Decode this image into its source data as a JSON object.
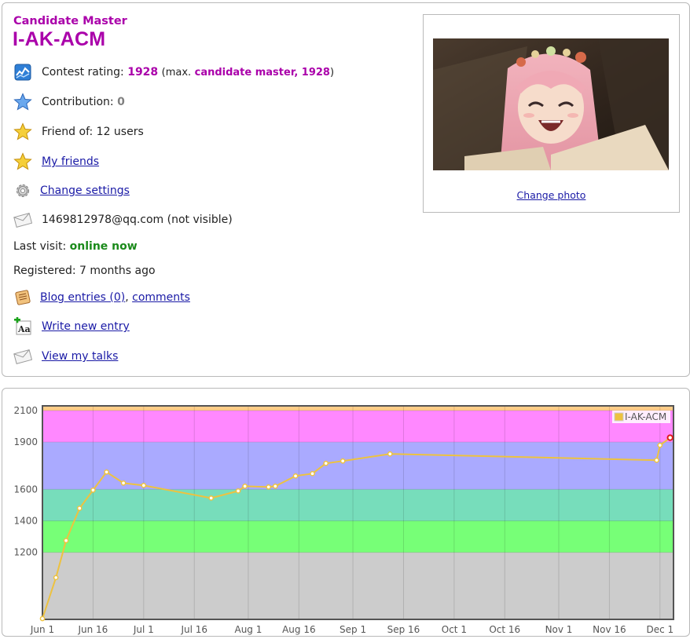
{
  "profile": {
    "rank": "Candidate Master",
    "handle": "I-AK-ACM",
    "contest_rating_label": "Contest rating:",
    "contest_rating_value": "1928",
    "max_prefix": "(max.",
    "max_value": "candidate master, 1928",
    "max_suffix": ")",
    "contribution_label": "Contribution:",
    "contribution_value": "0",
    "friend_of": "Friend of: 12 users",
    "my_friends": "My friends",
    "change_settings": "Change settings",
    "email": "1469812978@qq.com (not visible)",
    "last_visit_label": "Last visit:",
    "last_visit_value": "online now",
    "registered": "Registered: 7 months ago",
    "blog_entries": "Blog entries (0)",
    "comma": ",",
    "comments": "comments",
    "write_new_entry": "Write new entry",
    "view_my_talks": "View my talks",
    "change_photo": "Change photo"
  },
  "icons": {
    "rating": "rating-chart-icon",
    "contribution": "blue-star-icon",
    "friend_of": "gold-star-icon",
    "my_friends": "gold-star-icon",
    "settings": "gear-icon",
    "email": "envelope-icon",
    "blog": "blog-icon",
    "write": "write-entry-icon",
    "talks": "envelope-icon"
  },
  "colors": {
    "rank": "#aa00aa",
    "link": "#1a1aa6",
    "online": "#1a8a1a",
    "line": "#edc240"
  },
  "chart_data": {
    "type": "line",
    "legend": [
      "I-AK-ACM"
    ],
    "legend_position": "top-right",
    "x_ticks": [
      "Jun 1",
      "Jun 16",
      "Jul 1",
      "Jul 16",
      "Aug 1",
      "Aug 16",
      "Sep 1",
      "Sep 16",
      "Oct 1",
      "Oct 16",
      "Nov 1",
      "Nov 16",
      "Dec 1"
    ],
    "y_ticks": [
      1200,
      1400,
      1600,
      1900,
      2100
    ],
    "ylim": [
      775,
      2130
    ],
    "bands": [
      {
        "from": 775,
        "to": 1200,
        "color": "#cccccc"
      },
      {
        "from": 1200,
        "to": 1400,
        "color": "#77ff77"
      },
      {
        "from": 1400,
        "to": 1600,
        "color": "#77ddbb"
      },
      {
        "from": 1600,
        "to": 1900,
        "color": "#aaaaff"
      },
      {
        "from": 1900,
        "to": 2100,
        "color": "#ff88ff"
      },
      {
        "from": 2100,
        "to": 2130,
        "color": "#ffcc88"
      }
    ],
    "series": [
      {
        "name": "I-AK-ACM",
        "points": [
          {
            "x": "2021-06-01",
            "y": 780
          },
          {
            "x": "2021-06-05",
            "y": 1040
          },
          {
            "x": "2021-06-08",
            "y": 1275
          },
          {
            "x": "2021-06-12",
            "y": 1480
          },
          {
            "x": "2021-06-16",
            "y": 1595
          },
          {
            "x": "2021-06-20",
            "y": 1710
          },
          {
            "x": "2021-06-25",
            "y": 1640
          },
          {
            "x": "2021-07-01",
            "y": 1625
          },
          {
            "x": "2021-07-21",
            "y": 1545
          },
          {
            "x": "2021-07-29",
            "y": 1590
          },
          {
            "x": "2021-07-31",
            "y": 1620
          },
          {
            "x": "2021-08-07",
            "y": 1615
          },
          {
            "x": "2021-08-09",
            "y": 1620
          },
          {
            "x": "2021-08-15",
            "y": 1685
          },
          {
            "x": "2021-08-20",
            "y": 1700
          },
          {
            "x": "2021-08-24",
            "y": 1765
          },
          {
            "x": "2021-08-29",
            "y": 1780
          },
          {
            "x": "2021-09-12",
            "y": 1825
          },
          {
            "x": "2021-11-30",
            "y": 1785
          },
          {
            "x": "2021-12-01",
            "y": 1880
          },
          {
            "x": "2021-12-04",
            "y": 1928
          }
        ]
      }
    ]
  }
}
